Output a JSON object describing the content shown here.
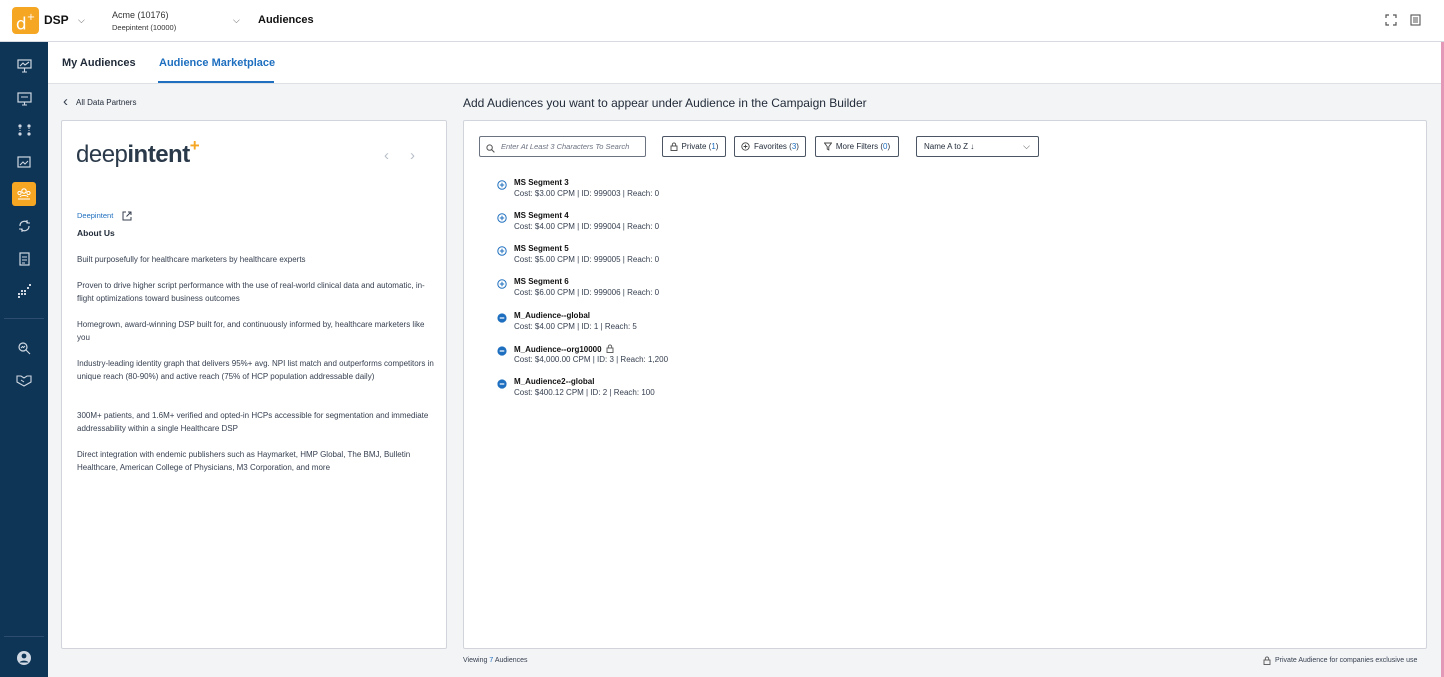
{
  "header": {
    "logo_glyph": "d",
    "logo_plus": "+",
    "brand": "DSP",
    "account_name": "Acme (10176)",
    "account_org": "Deepintent (10000)",
    "page_title": "Audiences"
  },
  "tabs": [
    {
      "label": "My Audiences",
      "active": false
    },
    {
      "label": "Audience Marketplace",
      "active": true
    }
  ],
  "back_link": "All Data Partners",
  "section_title": "Add Audiences you want to appear under Audience in the Campaign Builder",
  "partner": {
    "logo_light": "deep",
    "logo_bold": "intent",
    "logo_plus": "+",
    "link": "Deepintent",
    "about_heading": "About Us",
    "paragraphs": [
      "Built purposefully for healthcare marketers by healthcare experts",
      "Proven to drive higher script performance with the use of real-world clinical data and automatic, in-flight optimizations toward business outcomes",
      "Homegrown, award-winning DSP built for, and continuously informed by, healthcare marketers like you",
      "Industry-leading identity graph that delivers 95%+ avg. NPI list match and outperforms competitors in unique reach (80-90%) and active reach (75% of HCP population addressable daily)",
      "300M+ patients, and 1.6M+ verified and opted-in HCPs accessible for segmentation and immediate addressability within a single Healthcare DSP",
      "Direct integration with endemic publishers such as Haymarket, HMP Global, The BMJ, Bulletin Healthcare, American College of Physicians, M3 Corporation, and more"
    ]
  },
  "filters": {
    "search_placeholder": "Enter At Least 3 Characters To Search",
    "private_label": "Private (",
    "private_count": "1",
    "favorites_label": "Favorites (",
    "favorites_count": "3",
    "more_filters_label": "More Filters (",
    "more_filters_count": "0",
    "close_paren": ")",
    "sort_value": "Name A to Z  ↓"
  },
  "audiences": [
    {
      "name": "MS Segment 3",
      "meta": "Cost: $3.00 CPM | ID: 999003 | Reach: 0",
      "state": "add",
      "private": false
    },
    {
      "name": "MS Segment 4",
      "meta": "Cost: $4.00 CPM | ID: 999004 | Reach: 0",
      "state": "add",
      "private": false
    },
    {
      "name": "MS Segment 5",
      "meta": "Cost: $5.00 CPM | ID: 999005 | Reach: 0",
      "state": "add",
      "private": false
    },
    {
      "name": "MS Segment 6",
      "meta": "Cost: $6.00 CPM | ID: 999006 | Reach: 0",
      "state": "add",
      "private": false
    },
    {
      "name": "M_Audience--global",
      "meta": "Cost: $4.00 CPM | ID: 1 | Reach: 5",
      "state": "remove",
      "private": false
    },
    {
      "name": "M_Audience--org10000",
      "meta": "Cost: $4,000.00 CPM | ID: 3 | Reach: 1,200",
      "state": "remove",
      "private": true
    },
    {
      "name": "M_Audience2--global",
      "meta": "Cost: $400.12 CPM | ID: 2 | Reach: 100",
      "state": "remove",
      "private": false
    }
  ],
  "footer": {
    "viewing_prefix": "Viewing",
    "viewing_count": "7",
    "viewing_suffix": "Audiences",
    "private_note": "Private Audience for companies exclusive use"
  },
  "colors": {
    "accent": "#1e6fbf",
    "brand_orange": "#f5a623",
    "nav_bg": "#0f3556"
  },
  "nav_icons": [
    "presentation-icon",
    "billboard-icon",
    "network-icon",
    "creatives-icon",
    "audiences-icon",
    "sync-icon",
    "reports-icon",
    "insights-icon",
    "search-analytics-icon",
    "handshake-icon",
    "user-icon"
  ]
}
